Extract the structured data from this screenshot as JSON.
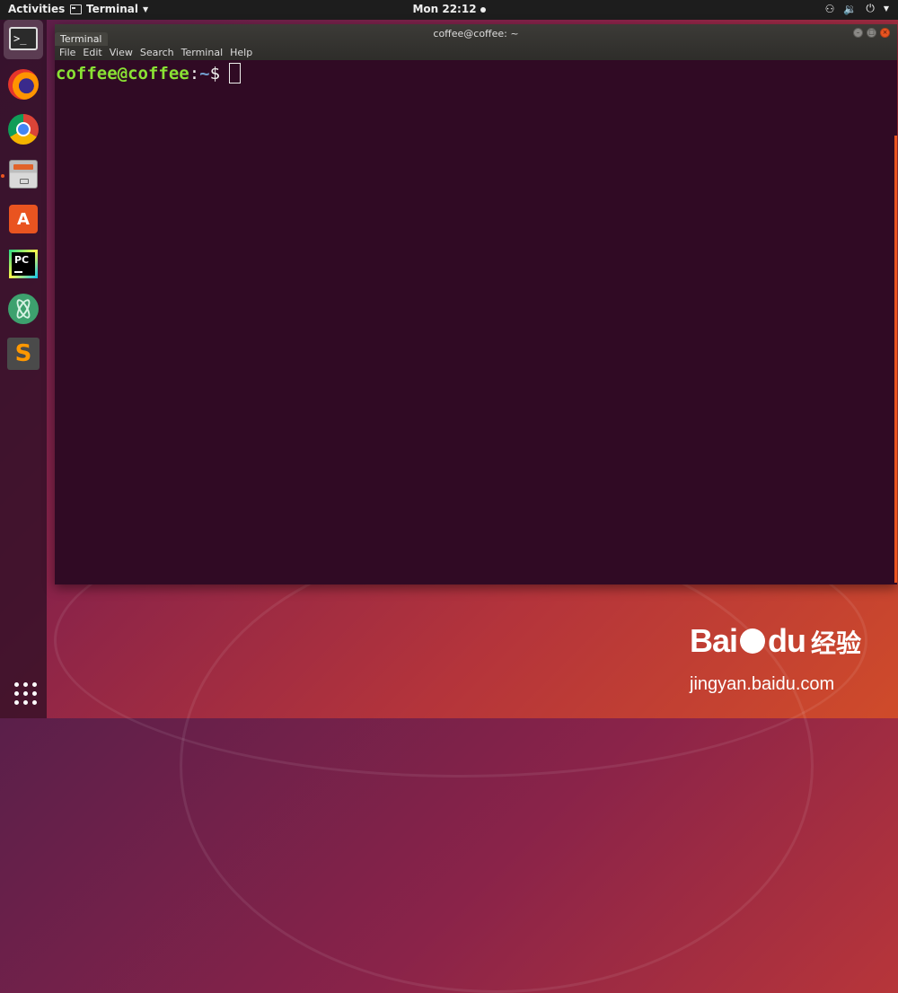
{
  "topbar": {
    "activities": "Activities",
    "app_menu": "Terminal",
    "clock": "Mon 22:12"
  },
  "dock": {
    "items": [
      "terminal",
      "firefox",
      "chrome",
      "files",
      "software",
      "pycharm",
      "atom",
      "sublime-text",
      "show-applications"
    ]
  },
  "window": {
    "title": "coffee@coffee: ~",
    "tab_tooltip": "Terminal",
    "menu": [
      "File",
      "Edit",
      "View",
      "Search",
      "Terminal",
      "Help"
    ]
  },
  "terminal": {
    "user_host": "coffee@coffee",
    "colon": ":",
    "path": "~",
    "symbol": "$"
  },
  "watermark": {
    "brand": "Bai",
    "brand2": "du",
    "cn": "经验",
    "url": "jingyan.baidu.com"
  },
  "colors": {
    "terminal_bg": "#300a24",
    "prompt_user": "#8ae234",
    "prompt_path": "#729fcf",
    "accent": "#e95420"
  }
}
